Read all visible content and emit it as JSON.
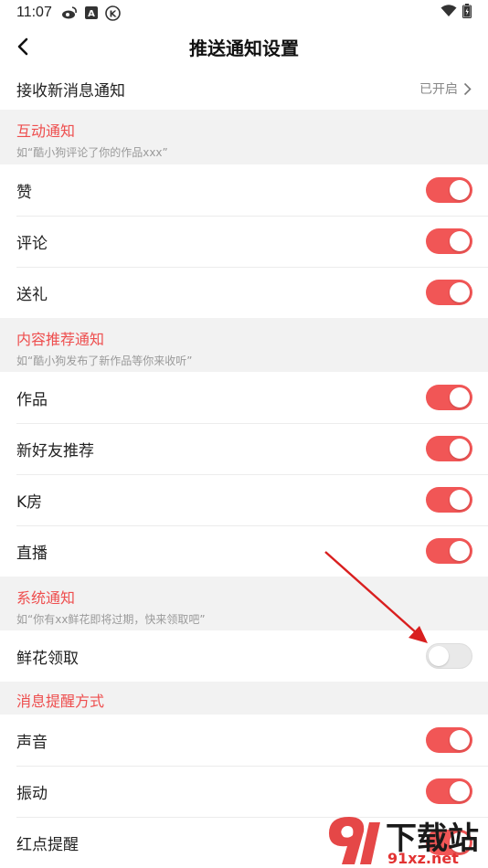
{
  "status_bar": {
    "time": "11:07",
    "icons": [
      "weibo-icon",
      "a-badge-icon",
      "k-circle-icon"
    ],
    "right_icons": [
      "wifi-icon",
      "battery-icon"
    ]
  },
  "header": {
    "title": "推送通知设置",
    "back_icon": "chevron-left-icon"
  },
  "receive": {
    "label": "接收新消息通知",
    "value": "已开启"
  },
  "sections": {
    "interaction": {
      "title": "互动通知",
      "subtitle": "如“酷小狗评论了你的作品xxx”",
      "items": [
        {
          "label": "赞",
          "on": true
        },
        {
          "label": "评论",
          "on": true
        },
        {
          "label": "送礼",
          "on": true
        }
      ]
    },
    "content": {
      "title": "内容推荐通知",
      "subtitle": "如“酷小狗发布了新作品等你来收听”",
      "items": [
        {
          "label": "作品",
          "on": true
        },
        {
          "label": "新好友推荐",
          "on": true
        },
        {
          "label": "K房",
          "on": true
        },
        {
          "label": "直播",
          "on": true
        }
      ]
    },
    "system": {
      "title": "系统通知",
      "subtitle": "如“你有xx鲜花即将过期，快来领取吧”",
      "items": [
        {
          "label": "鲜花领取",
          "on": false
        }
      ]
    },
    "reminder": {
      "title": "消息提醒方式",
      "items": [
        {
          "label": "声音",
          "on": true
        },
        {
          "label": "振动",
          "on": true
        },
        {
          "label": "红点提醒",
          "on": true
        }
      ]
    }
  },
  "colors": {
    "accent": "#ee4e4e",
    "toggle_on": "#f15656",
    "toggle_off": "#e9e9e9",
    "section_bg": "#f2f2f2",
    "annotation_arrow": "#d91f1f"
  },
  "watermark": {
    "big": "下载站",
    "small": "91xz.net"
  }
}
